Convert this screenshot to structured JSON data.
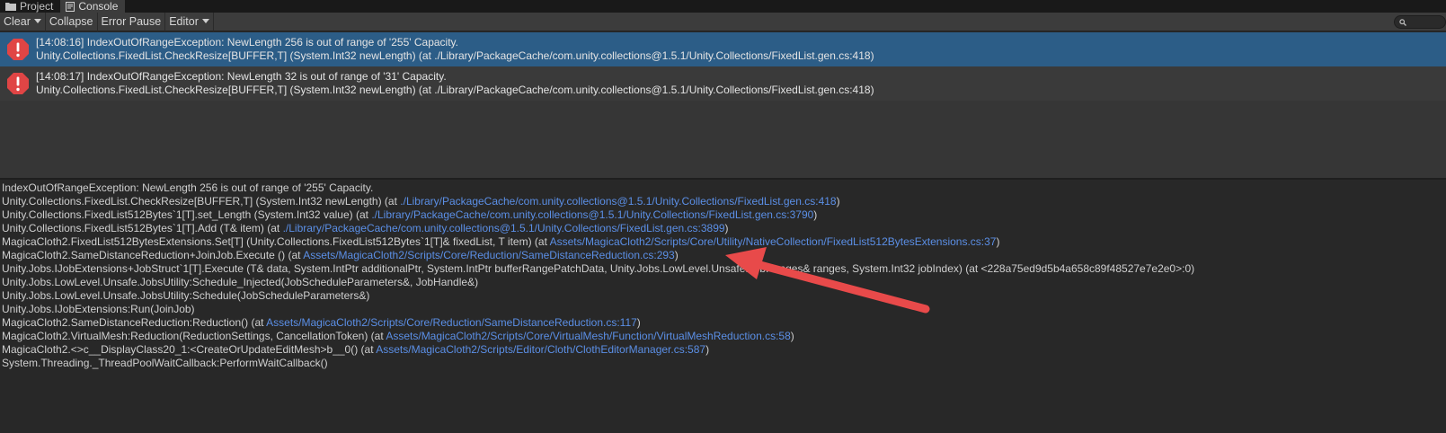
{
  "tabs": [
    {
      "label": "Project",
      "icon": "folder-icon"
    },
    {
      "label": "Console",
      "icon": "console-icon"
    }
  ],
  "toolbar": {
    "clear_label": "Clear",
    "collapse_label": "Collapse",
    "error_pause_label": "Error Pause",
    "editor_label": "Editor"
  },
  "search": {
    "icon": "search-icon",
    "value": ""
  },
  "entries": [
    {
      "line1": "[14:08:16] IndexOutOfRangeException: NewLength 256 is out of range of '255' Capacity.",
      "line2": "Unity.Collections.FixedList.CheckResize[BUFFER,T] (System.Int32 newLength) (at ./Library/PackageCache/com.unity.collections@1.5.1/Unity.Collections/FixedList.gen.cs:418)",
      "selected": true
    },
    {
      "line1": "[14:08:17] IndexOutOfRangeException: NewLength 32 is out of range of '31' Capacity.",
      "line2": "Unity.Collections.FixedList.CheckResize[BUFFER,T] (System.Int32 newLength) (at ./Library/PackageCache/com.unity.collections@1.5.1/Unity.Collections/FixedList.gen.cs:418)",
      "selected": false
    }
  ],
  "detail": [
    {
      "text": "IndexOutOfRangeException: NewLength 256 is out of range of '255' Capacity.",
      "link": "",
      "suffix": ""
    },
    {
      "text": "Unity.Collections.FixedList.CheckResize[BUFFER,T] (System.Int32 newLength) (at ",
      "link": "./Library/PackageCache/com.unity.collections@1.5.1/Unity.Collections/FixedList.gen.cs:418",
      "suffix": ")"
    },
    {
      "text": "Unity.Collections.FixedList512Bytes`1[T].set_Length (System.Int32 value) (at ",
      "link": "./Library/PackageCache/com.unity.collections@1.5.1/Unity.Collections/FixedList.gen.cs:3790",
      "suffix": ")"
    },
    {
      "text": "Unity.Collections.FixedList512Bytes`1[T].Add (T& item) (at ",
      "link": "./Library/PackageCache/com.unity.collections@1.5.1/Unity.Collections/FixedList.gen.cs:3899",
      "suffix": ")"
    },
    {
      "text": "MagicaCloth2.FixedList512BytesExtensions.Set[T] (Unity.Collections.FixedList512Bytes`1[T]& fixedList, T item) (at ",
      "link": "Assets/MagicaCloth2/Scripts/Core/Utility/NativeCollection/FixedList512BytesExtensions.cs:37",
      "suffix": ")"
    },
    {
      "text": "MagicaCloth2.SameDistanceReduction+JoinJob.Execute () (at ",
      "link": "Assets/MagicaCloth2/Scripts/Core/Reduction/SameDistanceReduction.cs:293",
      "suffix": ")"
    },
    {
      "text": "Unity.Jobs.IJobExtensions+JobStruct`1[T].Execute (T& data, System.IntPtr additionalPtr, System.IntPtr bufferRangePatchData, Unity.Jobs.LowLevel.Unsafe.JobRanges& ranges, System.Int32 jobIndex) (at <228a75ed9d5b4a658c89f48527e7e2e0>:0)",
      "link": "",
      "suffix": ""
    },
    {
      "text": "Unity.Jobs.LowLevel.Unsafe.JobsUtility:Schedule_Injected(JobScheduleParameters&, JobHandle&)",
      "link": "",
      "suffix": ""
    },
    {
      "text": "Unity.Jobs.LowLevel.Unsafe.JobsUtility:Schedule(JobScheduleParameters&)",
      "link": "",
      "suffix": ""
    },
    {
      "text": "Unity.Jobs.IJobExtensions:Run(JoinJob)",
      "link": "",
      "suffix": ""
    },
    {
      "text": "MagicaCloth2.SameDistanceReduction:Reduction() (at ",
      "link": "Assets/MagicaCloth2/Scripts/Core/Reduction/SameDistanceReduction.cs:117",
      "suffix": ")"
    },
    {
      "text": "MagicaCloth2.VirtualMesh:Reduction(ReductionSettings, CancellationToken) (at ",
      "link": "Assets/MagicaCloth2/Scripts/Core/VirtualMesh/Function/VirtualMeshReduction.cs:58",
      "suffix": ")"
    },
    {
      "text": "MagicaCloth2.<>c__DisplayClass20_1:<CreateOrUpdateEditMesh>b__0() (at ",
      "link": "Assets/MagicaCloth2/Scripts/Editor/Cloth/ClothEditorManager.cs:587",
      "suffix": ")"
    },
    {
      "text": "System.Threading._ThreadPoolWaitCallback:PerformWaitCallback()",
      "link": "",
      "suffix": ""
    }
  ],
  "annotation": {
    "type": "arrow",
    "color": "#e84a4a",
    "icon": "annotation-arrow"
  },
  "colors": {
    "accent_selected": "#2c5d87",
    "link": "#5b8fe6",
    "error": "#e04545"
  }
}
